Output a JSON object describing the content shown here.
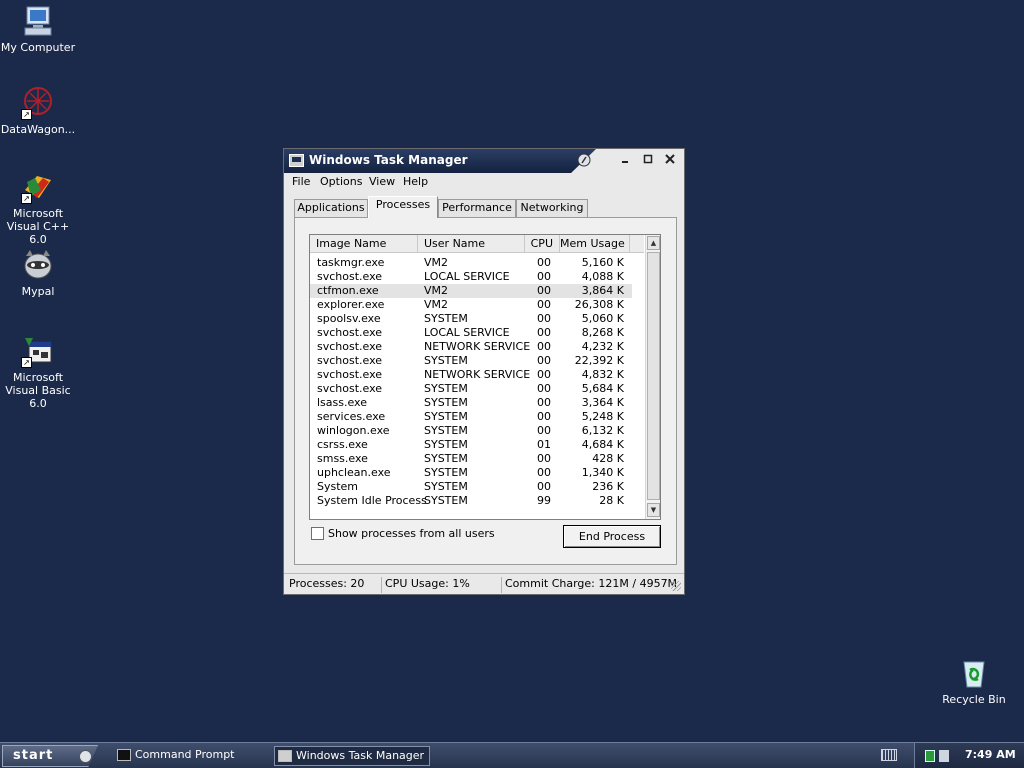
{
  "desktop": {
    "icons": [
      {
        "label": "My Computer",
        "icon": "computer-icon"
      },
      {
        "label": "DataWagon...",
        "icon": "datawagon-icon"
      },
      {
        "label": "Microsoft Visual C++ 6.0",
        "icon": "visual-cpp-icon"
      },
      {
        "label": "Mypal",
        "icon": "mypal-icon"
      },
      {
        "label": "Microsoft Visual Basic 6.0",
        "icon": "visual-basic-icon"
      },
      {
        "label": "Recycle Bin",
        "icon": "recycle-bin-icon"
      }
    ],
    "background_color": "#1b2a4a"
  },
  "window": {
    "title": "Windows Task Manager",
    "menu": [
      "File",
      "Options",
      "View",
      "Help"
    ],
    "tabs": [
      "Applications",
      "Processes",
      "Performance",
      "Networking"
    ],
    "active_tab": "Processes",
    "columns": [
      "Image Name",
      "User Name",
      "CPU",
      "Mem Usage"
    ],
    "processes": [
      {
        "name": "taskmgr.exe",
        "user": "VM2",
        "cpu": "00",
        "mem": "5,160 K"
      },
      {
        "name": "svchost.exe",
        "user": "LOCAL SERVICE",
        "cpu": "00",
        "mem": "4,088 K"
      },
      {
        "name": "ctfmon.exe",
        "user": "VM2",
        "cpu": "00",
        "mem": "3,864 K"
      },
      {
        "name": "explorer.exe",
        "user": "VM2",
        "cpu": "00",
        "mem": "26,308 K"
      },
      {
        "name": "spoolsv.exe",
        "user": "SYSTEM",
        "cpu": "00",
        "mem": "5,060 K"
      },
      {
        "name": "svchost.exe",
        "user": "LOCAL SERVICE",
        "cpu": "00",
        "mem": "8,268 K"
      },
      {
        "name": "svchost.exe",
        "user": "NETWORK SERVICE",
        "cpu": "00",
        "mem": "4,232 K"
      },
      {
        "name": "svchost.exe",
        "user": "SYSTEM",
        "cpu": "00",
        "mem": "22,392 K"
      },
      {
        "name": "svchost.exe",
        "user": "NETWORK SERVICE",
        "cpu": "00",
        "mem": "4,832 K"
      },
      {
        "name": "svchost.exe",
        "user": "SYSTEM",
        "cpu": "00",
        "mem": "5,684 K"
      },
      {
        "name": "lsass.exe",
        "user": "SYSTEM",
        "cpu": "00",
        "mem": "3,364 K"
      },
      {
        "name": "services.exe",
        "user": "SYSTEM",
        "cpu": "00",
        "mem": "5,248 K"
      },
      {
        "name": "winlogon.exe",
        "user": "SYSTEM",
        "cpu": "00",
        "mem": "6,132 K"
      },
      {
        "name": "csrss.exe",
        "user": "SYSTEM",
        "cpu": "01",
        "mem": "4,684 K"
      },
      {
        "name": "smss.exe",
        "user": "SYSTEM",
        "cpu": "00",
        "mem": "428 K"
      },
      {
        "name": "uphclean.exe",
        "user": "SYSTEM",
        "cpu": "00",
        "mem": "1,340 K"
      },
      {
        "name": "System",
        "user": "SYSTEM",
        "cpu": "00",
        "mem": "236 K"
      },
      {
        "name": "System Idle Process",
        "user": "SYSTEM",
        "cpu": "99",
        "mem": "28 K"
      }
    ],
    "selected_process": "ctfmon.exe",
    "show_all_users_label": "Show processes from all users",
    "show_all_users_checked": false,
    "end_process_label": "End Process",
    "status": {
      "processes": "Processes: 20",
      "cpu": "CPU Usage: 1%",
      "commit": "Commit Charge: 121M / 4957M"
    }
  },
  "taskbar": {
    "start_label": "start",
    "tasks": [
      {
        "label": "Command Prompt",
        "icon": "command-prompt-icon",
        "active": false
      },
      {
        "label": "Windows Task Manager",
        "icon": "task-manager-icon",
        "active": true
      }
    ],
    "clock": "7:49 AM"
  }
}
